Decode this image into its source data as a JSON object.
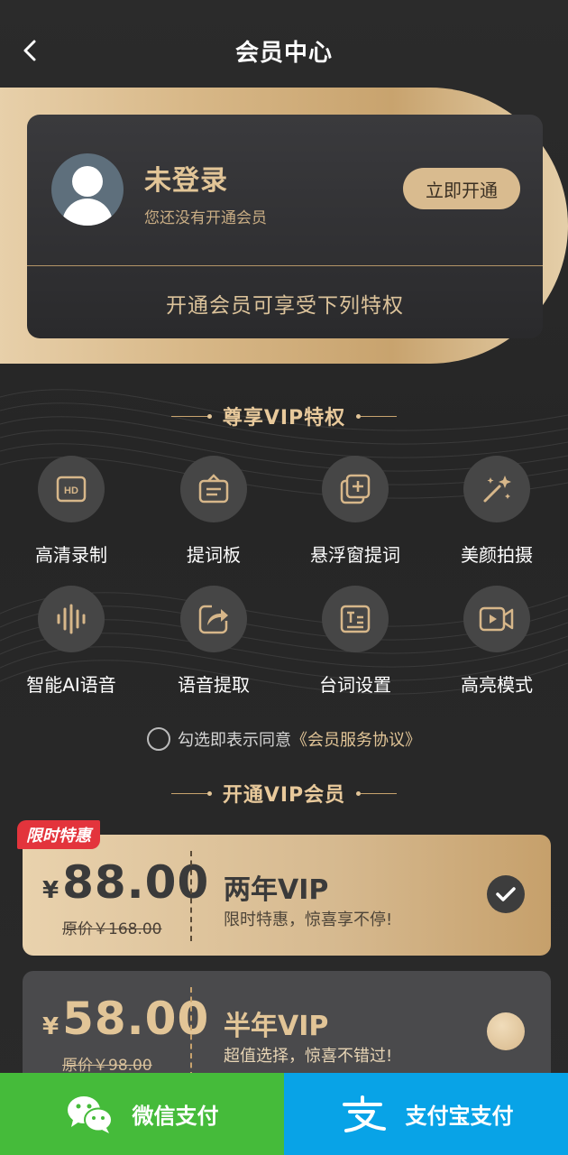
{
  "header": {
    "title": "会员中心"
  },
  "user_card": {
    "name": "未登录",
    "status": "您还没有开通会员",
    "open_button": "立即开通",
    "privilege_hint": "开通会员可享受下列特权"
  },
  "privileges_section": {
    "title": "尊享VIP特权",
    "items": [
      {
        "label": "高清录制",
        "icon": "hd-icon"
      },
      {
        "label": "提词板",
        "icon": "teleprompter-board-icon"
      },
      {
        "label": "悬浮窗提词",
        "icon": "floating-window-icon"
      },
      {
        "label": "美颜拍摄",
        "icon": "magic-wand-icon"
      },
      {
        "label": "智能AI语音",
        "icon": "voice-wave-icon"
      },
      {
        "label": "语音提取",
        "icon": "share-extract-icon"
      },
      {
        "label": "台词设置",
        "icon": "script-settings-icon"
      },
      {
        "label": "高亮模式",
        "icon": "video-camera-icon"
      }
    ]
  },
  "agreement": {
    "text": "勾选即表示同意",
    "link": "《会员服务协议》"
  },
  "plans_section": {
    "title": "开通VIP会员",
    "promo_tag": "限时特惠",
    "plans": [
      {
        "currency": "¥",
        "price": "88.00",
        "original": "原价￥168.00",
        "name": "两年VIP",
        "desc": "限时特惠，惊喜享不停!",
        "selected": true
      },
      {
        "currency": "¥",
        "price": "58.00",
        "original": "原价￥98.00",
        "name": "半年VIP",
        "desc": "超值选择，惊喜不错过!",
        "selected": false
      }
    ]
  },
  "payment": {
    "wechat": "微信支付",
    "alipay": "支付宝支付"
  },
  "colors": {
    "gold": "#d8b888",
    "gold_text": "#e2c597",
    "wechat_green": "#45bb3a",
    "alipay_blue": "#08a3e7",
    "promo_red": "#e3343c"
  }
}
